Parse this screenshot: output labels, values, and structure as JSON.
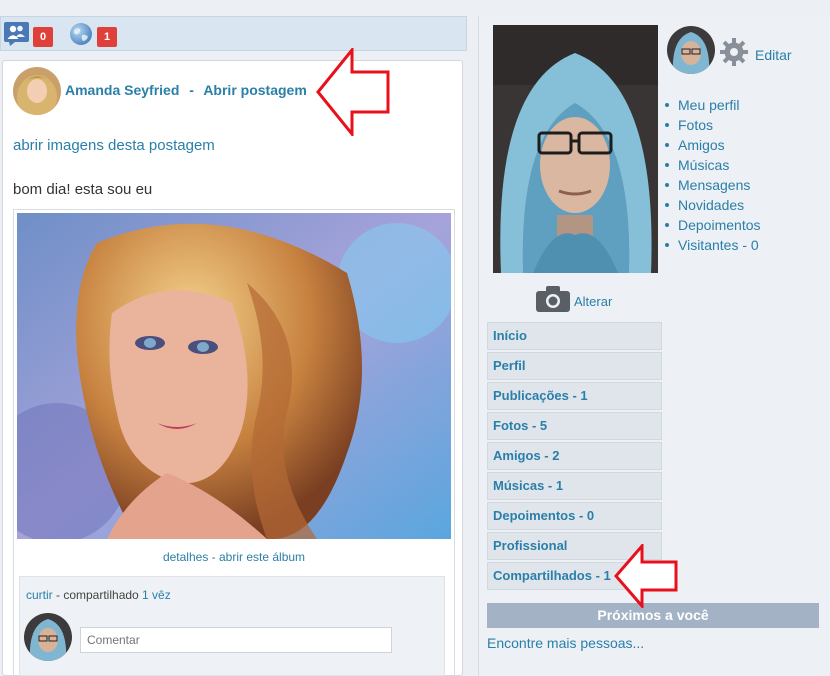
{
  "topbar": {
    "friend_requests_count": "0",
    "notifications_count": "1"
  },
  "post": {
    "author": "Amanda Seyfried",
    "separator": "-",
    "open_post_label": "Abrir postagem",
    "open_images_label": "abrir imagens desta postagem",
    "text": "bom dia! esta sou eu",
    "photo_caption_details": "detalhes",
    "photo_caption_sep": " - ",
    "photo_caption_album": "abrir este álbum",
    "like_label": "curtir",
    "shared_text": " - compartilhado ",
    "shared_count_label": "1 vêz",
    "comment_placeholder": "Comentar"
  },
  "profile": {
    "edit_label": "Editar",
    "change_photo_label": "Alterar",
    "links": [
      "Meu perfil",
      "Fotos",
      "Amigos",
      "Músicas",
      "Mensagens",
      "Novidades",
      "Depoimentos",
      "Visitantes - 0"
    ],
    "nav": [
      "Início",
      "Perfil",
      "Publicações - 1",
      "Fotos - 5",
      "Amigos - 2",
      "Músicas - 1",
      "Depoimentos - 0",
      "Profissional",
      "Compartilhados - 1"
    ],
    "near_you_label": "Próximos a você",
    "find_more_label": "Encontre mais pessoas..."
  },
  "icons": {
    "friends": "people-icon",
    "globe": "globe-icon",
    "settings": "gear-icon",
    "camera": "camera-icon",
    "annotation": "red-arrow-icon"
  },
  "colors": {
    "link": "#2a7fa9",
    "badge": "#e0403a",
    "annotation_arrow": "#e8101a"
  }
}
